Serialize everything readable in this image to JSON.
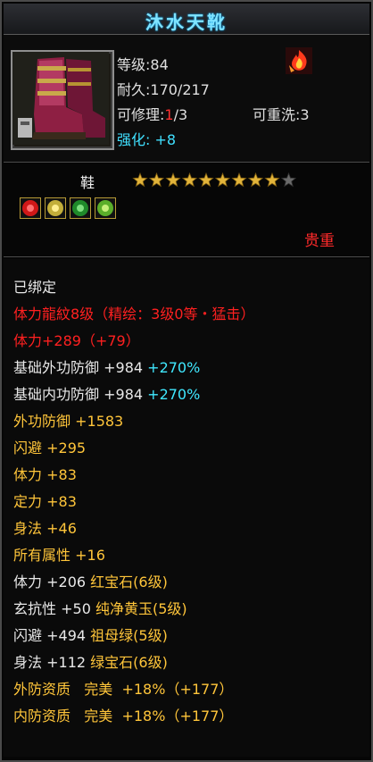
{
  "item": {
    "name": "沐水天靴",
    "type": "鞋",
    "rarity": "贵重",
    "star_count": 10,
    "stars_filled": 9,
    "icon": "boots-icon",
    "badge_icon": "flame-emblem-icon"
  },
  "stats": {
    "level": "等级:84",
    "durability": "耐久:170/217",
    "repair_prefix": "可修理:",
    "repair_current": "1",
    "repair_suffix": "/3",
    "rewash": "可重洗:3",
    "enhance": "强化: +8"
  },
  "gems": [
    {
      "icon": "red-gem-icon",
      "color": "#d01818"
    },
    {
      "icon": "yellow-jade-icon",
      "color": "#d6c24a"
    },
    {
      "icon": "green-emerald-icon",
      "color": "#2fa23a"
    },
    {
      "icon": "green-sapphire-icon",
      "color": "#6fc23a"
    }
  ],
  "attributes": [
    {
      "label": "已绑定",
      "value": "",
      "extra": "",
      "color": "white"
    },
    {
      "label": "体力龍紋8级（精绘：3级0等・猛击）",
      "value": "",
      "extra": "",
      "color": "red"
    },
    {
      "label": "体力+289（+79）",
      "value": "",
      "extra": "",
      "color": "red"
    },
    {
      "label": "基础外功防御",
      "value": "+984",
      "extra": "+270%",
      "color": "white"
    },
    {
      "label": "基础内功防御",
      "value": "+984",
      "extra": "+270%",
      "color": "white"
    },
    {
      "label": "外功防御",
      "value": "+1583",
      "extra": "",
      "color": "yellow"
    },
    {
      "label": "闪避",
      "value": "+295",
      "extra": "",
      "color": "yellow"
    },
    {
      "label": "体力",
      "value": "+83",
      "extra": "",
      "color": "yellow"
    },
    {
      "label": "定力",
      "value": "+83",
      "extra": "",
      "color": "yellow"
    },
    {
      "label": "身法",
      "value": "+46",
      "extra": "",
      "color": "yellow"
    },
    {
      "label": "所有属性",
      "value": "+16",
      "extra": "",
      "color": "yellow"
    },
    {
      "label": "体力",
      "value": "+206",
      "extra": "红宝石(6级)",
      "color": "gem"
    },
    {
      "label": "玄抗性",
      "value": "+50",
      "extra": "纯净黄玉(5级)",
      "color": "gem"
    },
    {
      "label": "闪避",
      "value": "+494",
      "extra": "祖母绿(5级)",
      "color": "gem"
    },
    {
      "label": "身法",
      "value": "+112",
      "extra": "绿宝石(6级)",
      "color": "gem"
    },
    {
      "label": "外防资质",
      "value": "完美",
      "extra": "+18%（+177）",
      "color": "quality"
    },
    {
      "label": "内防资质",
      "value": "完美",
      "extra": "+18%（+177）",
      "color": "quality"
    }
  ]
}
